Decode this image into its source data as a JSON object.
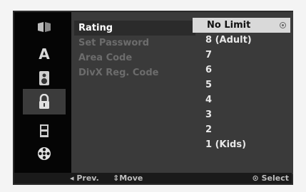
{
  "sidebar": {
    "icons": [
      "disc-icon",
      "language-a-icon",
      "speaker-icon",
      "lock-icon",
      "film-icon",
      "reel-icon"
    ]
  },
  "menu": {
    "items": [
      {
        "label": "Rating",
        "active": true
      },
      {
        "label": "Set Password",
        "active": false
      },
      {
        "label": "Area Code",
        "active": false
      },
      {
        "label": "DivX Reg. Code",
        "active": false
      }
    ]
  },
  "options": {
    "items": [
      "No Limit",
      "8  (Adult)",
      "7",
      "6",
      "5",
      "4",
      "3",
      "2",
      "1  (Kids)"
    ],
    "selected_index": 0
  },
  "footer": {
    "prev": "◂ Prev.",
    "move": "⇕Move",
    "select": "⊙ Select"
  }
}
